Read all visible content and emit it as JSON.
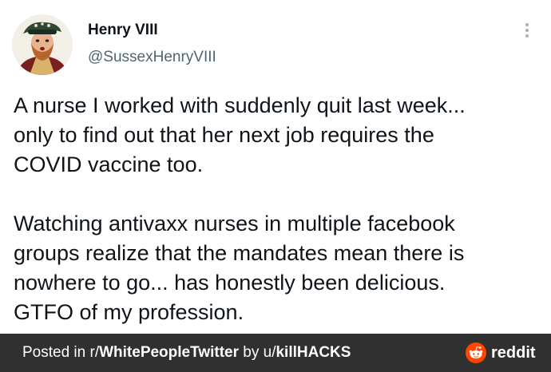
{
  "tweet": {
    "display_name": "Henry VIII",
    "handle": "@SussexHenryVIII",
    "avatar_icon": "portrait-avatar",
    "more_icon": "more-options-icon",
    "lines": [
      "A nurse I worked with suddenly quit last week...",
      "only to find out that her next job requires the",
      "COVID vaccine too.",
      "Watching antivaxx nurses in multiple facebook",
      "groups realize that the mandates mean there is",
      "nowhere to go... has honestly been delicious.",
      "GTFO of my profession."
    ]
  },
  "footer": {
    "posted_prefix": "Posted in r/",
    "subreddit": "WhitePeopleTwitter",
    "by_prefix": " by u/",
    "username": "killHACKS",
    "brand": "reddit",
    "brand_color": "#ff4500",
    "background": "#303030"
  }
}
